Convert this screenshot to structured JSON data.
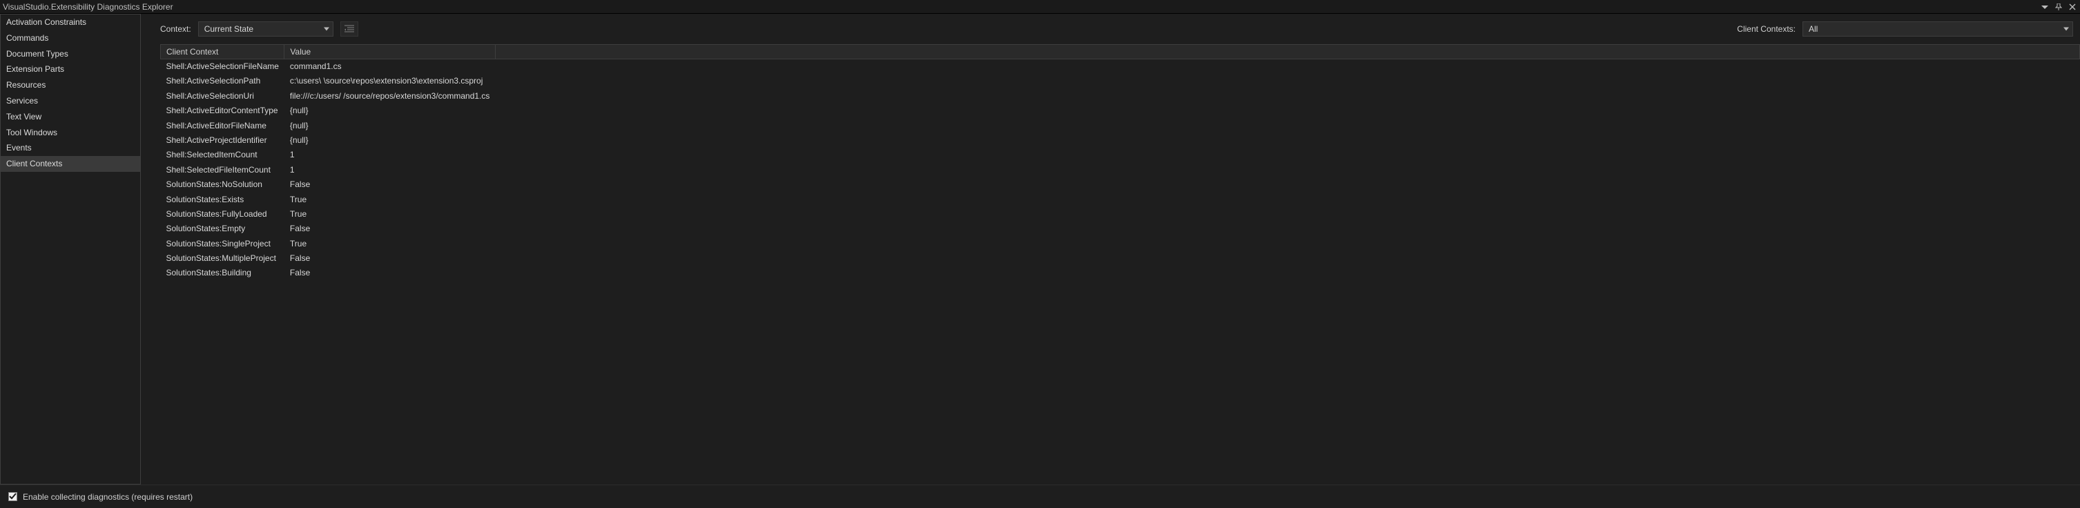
{
  "window": {
    "title": "VisualStudio.Extensibility Diagnostics Explorer"
  },
  "sidebar": {
    "items": [
      {
        "label": "Activation Constraints",
        "selected": false
      },
      {
        "label": "Commands",
        "selected": false
      },
      {
        "label": "Document Types",
        "selected": false
      },
      {
        "label": "Extension Parts",
        "selected": false
      },
      {
        "label": "Resources",
        "selected": false
      },
      {
        "label": "Services",
        "selected": false
      },
      {
        "label": "Text View",
        "selected": false
      },
      {
        "label": "Tool Windows",
        "selected": false
      },
      {
        "label": "Events",
        "selected": false
      },
      {
        "label": "Client Contexts",
        "selected": true
      }
    ]
  },
  "toolbar": {
    "context_label": "Context:",
    "context_value": "Current State",
    "client_contexts_label": "Client Contexts:",
    "client_contexts_value": "All"
  },
  "table": {
    "columns": [
      "Client Context",
      "Value",
      ""
    ],
    "rows": [
      {
        "key": "Shell:ActiveSelectionFileName",
        "value": "command1.cs"
      },
      {
        "key": "Shell:ActiveSelectionPath",
        "value": "c:\\users\\          \\source\\repos\\extension3\\extension3.csproj"
      },
      {
        "key": "Shell:ActiveSelectionUri",
        "value": "file:///c:/users/          /source/repos/extension3/command1.cs"
      },
      {
        "key": "Shell:ActiveEditorContentType",
        "value": "{null}"
      },
      {
        "key": "Shell:ActiveEditorFileName",
        "value": "{null}"
      },
      {
        "key": "Shell:ActiveProjectIdentifier",
        "value": "{null}"
      },
      {
        "key": "Shell:SelectedItemCount",
        "value": "1"
      },
      {
        "key": "Shell:SelectedFileItemCount",
        "value": "1"
      },
      {
        "key": "SolutionStates:NoSolution",
        "value": "False"
      },
      {
        "key": "SolutionStates:Exists",
        "value": "True"
      },
      {
        "key": "SolutionStates:FullyLoaded",
        "value": "True"
      },
      {
        "key": "SolutionStates:Empty",
        "value": "False"
      },
      {
        "key": "SolutionStates:SingleProject",
        "value": "True"
      },
      {
        "key": "SolutionStates:MultipleProject",
        "value": "False"
      },
      {
        "key": "SolutionStates:Building",
        "value": "False"
      }
    ]
  },
  "footer": {
    "checkbox_checked": true,
    "label": "Enable collecting diagnostics (requires restart)"
  }
}
